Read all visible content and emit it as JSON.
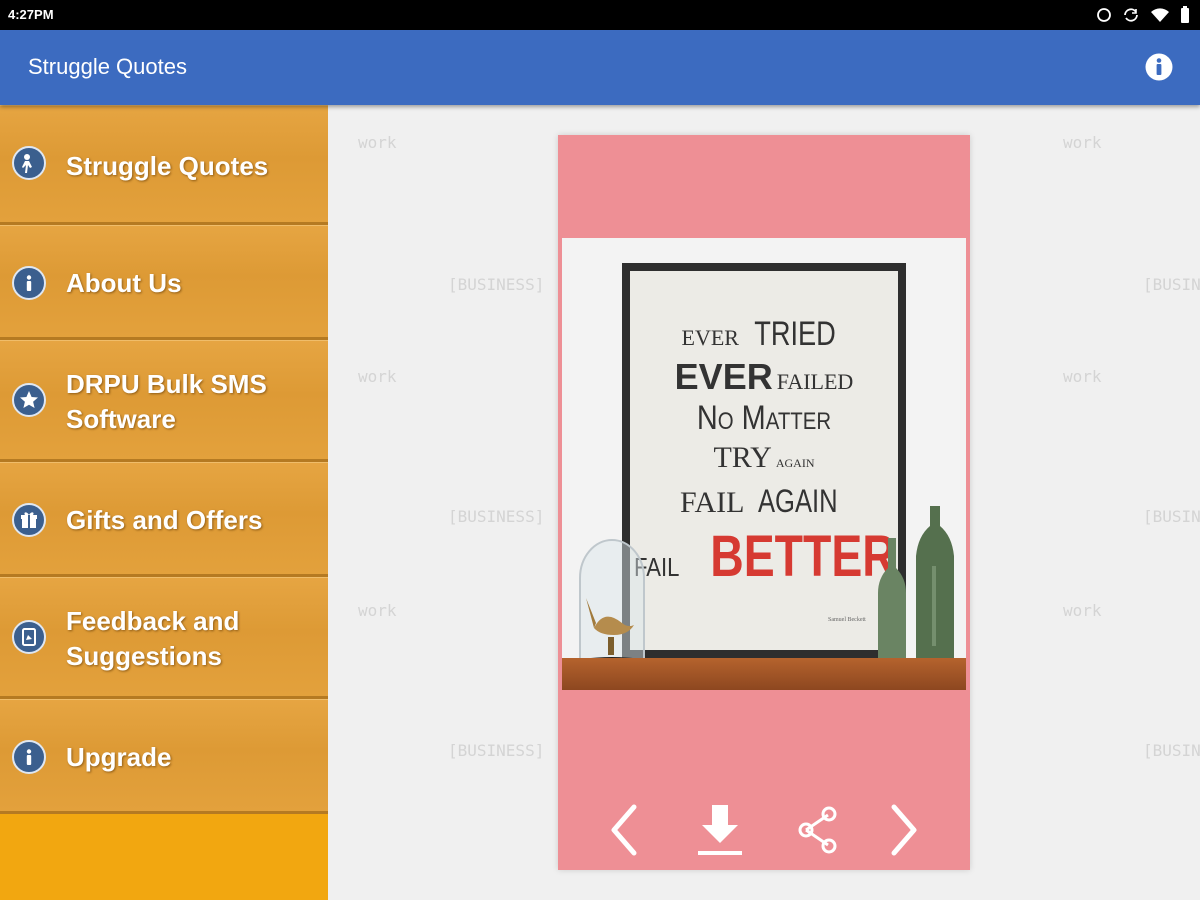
{
  "status": {
    "time": "4:27PM"
  },
  "appbar": {
    "title": "Struggle Quotes"
  },
  "drawer": {
    "items": [
      {
        "label": "Struggle Quotes",
        "icon": "person-icon"
      },
      {
        "label": "About Us",
        "icon": "info-icon"
      },
      {
        "label": "DRPU Bulk SMS Software",
        "line1": "DRPU Bulk SMS",
        "line2": "Software",
        "icon": "star-icon"
      },
      {
        "label": "Gifts and Offers",
        "icon": "gift-icon"
      },
      {
        "label": "Feedback and Suggestions",
        "line1": "Feedback and",
        "line2": "Suggestions",
        "icon": "feedback-icon"
      },
      {
        "label": "Upgrade",
        "icon": "info-icon"
      }
    ]
  },
  "background": {
    "doodle_work": "work",
    "doodle_business": "[BUSINESS]"
  },
  "quote": {
    "l1a": "EVER",
    "l1b": "TRIED",
    "l2a": "EVER",
    "l2b": "FAILED",
    "l3": "No Matter",
    "l4a": "TRY",
    "l4b": "AGAIN",
    "l5a": "FAIL",
    "l5b": "AGAIN",
    "l6a": "FAIL",
    "l6b": "BETTER",
    "author": "Samuel Beckett"
  },
  "colors": {
    "appbar": "#3c6bc0",
    "drawer": "#f2a710",
    "card": "#ee8f95",
    "accent_red": "#d63a32"
  }
}
